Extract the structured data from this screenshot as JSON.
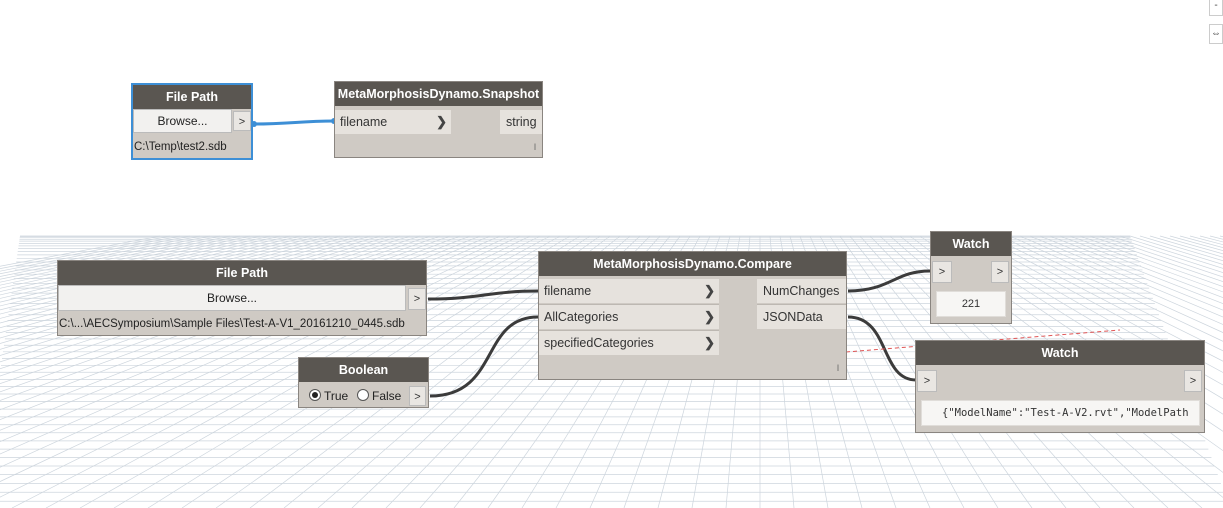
{
  "nodes": {
    "filepath_top": {
      "title": "File Path",
      "browse_label": "Browse...",
      "out_arrow": ">",
      "path": "C:\\Temp\\test2.sdb"
    },
    "snapshot": {
      "title": "MetaMorphosisDynamo.Snapshot",
      "inputs": [
        "filename"
      ],
      "outputs": [
        "string"
      ],
      "lacing": "l"
    },
    "filepath_bottom": {
      "title": "File Path",
      "browse_label": "Browse...",
      "out_arrow": ">",
      "path": "C:\\...\\AECSymposium\\Sample Files\\Test-A-V1_20161210_0445.sdb"
    },
    "boolean": {
      "title": "Boolean",
      "true_label": "True",
      "false_label": "False",
      "selected": "True",
      "out_arrow": ">"
    },
    "compare": {
      "title": "MetaMorphosisDynamo.Compare",
      "inputs": [
        "filename",
        "AllCategories",
        "specifiedCategories"
      ],
      "outputs": [
        "NumChanges",
        "JSONData"
      ],
      "lacing": "l"
    },
    "watch_num": {
      "title": "Watch",
      "in_arrow": ">",
      "out_arrow": ">",
      "value": "221"
    },
    "watch_json": {
      "title": "Watch",
      "in_arrow": ">",
      "out_arrow": ">",
      "value": "{\"ModelName\":\"Test-A-V2.rvt\",\"ModelPath"
    }
  },
  "side_controls": [
    "-",
    "⇔"
  ],
  "colors": {
    "node_header": "#5a5651",
    "node_body": "#cfcac4",
    "selected_border": "#3d8fd6",
    "wire": "#3b3b3b",
    "selected_wire": "#3d8fd6",
    "grid": "#c9d3dc"
  }
}
